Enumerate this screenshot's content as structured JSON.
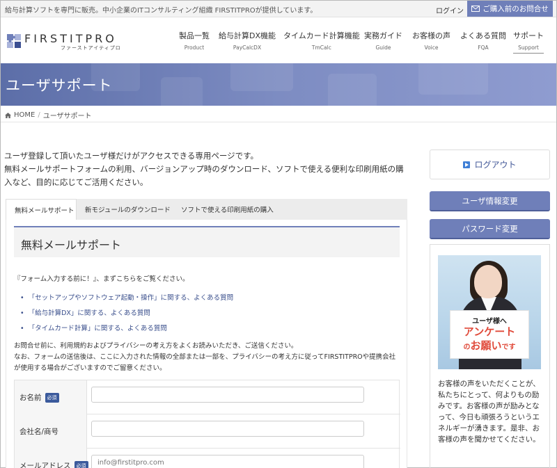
{
  "topbar": {
    "tagline": "給与計算ソフトを専門に販売。中小企業のITコンサルティング組織 FIRSTITPROが提供しています。",
    "login": "ログイン",
    "contact": "ご購入前のお問合せ"
  },
  "logo": {
    "name": "FIRSTITPRO",
    "kana": "ファーストアイティプロ"
  },
  "nav": [
    {
      "jp": "製品一覧",
      "en": "Product"
    },
    {
      "jp": "給与計算DX機能",
      "en": "PayCalcDX"
    },
    {
      "jp": "タイムカード計算機能",
      "en": "TmCalc"
    },
    {
      "jp": "実務ガイド",
      "en": "Guide"
    },
    {
      "jp": "お客様の声",
      "en": "Voice"
    },
    {
      "jp": "よくある質問",
      "en": "FQA"
    },
    {
      "jp": "サポート",
      "en": "Support"
    }
  ],
  "hero": {
    "title": "ユーザサポート"
  },
  "breadcrumb": {
    "home": "HOME",
    "sep": "/",
    "current": "ユーザサポート"
  },
  "intro": {
    "line1": "ユーザ登録して頂いたユーザ様だけがアクセスできる専用ページです。",
    "line2": "無料メールサポートフォームの利用、バージョンアップ時のダウンロード、ソフトで使える便利な印刷用紙の購入など、目的に応じてご活用ください。"
  },
  "tabs": [
    "無料メールサポート",
    "新モジュールのダウンロード",
    "ソフトで使える印刷用紙の購入"
  ],
  "section": {
    "title": "無料メールサポート"
  },
  "note": "『フォーム入力する前に！』、まずこちらをご覧ください。",
  "faq": [
    "「セットアップやソフトウェア起動・操作」に関する、よくある質問",
    "「給与計算DX」に関する、よくある質問",
    "「タイムカード計算」に関する、よくある質問"
  ],
  "notice": {
    "line1": "お問合せ前に、利用規約およびプライバシーの考え方をよくお読みいただき、ご送信ください。",
    "line2": "なお、フォームの送信後は、ここに入力された情報の全部または一部を、プライバシーの考え方に従ってFIRSTITPROや提携会社が使用する場合がございますのでご留意ください。"
  },
  "form": {
    "required": "必須",
    "name_label": "お名前",
    "company_label": "会社名/商号",
    "email_label": "メールアドレス",
    "email_placeholder": "info@firstitpro.com"
  },
  "sidebar": {
    "logout": "ログアウト",
    "user_info": "ユーザ情報変更",
    "password": "パスワード変更",
    "sign1": "ユーザ様へ",
    "sign2": "アンケート",
    "sign3a": "の",
    "sign3b": "お願い",
    "sign3c": "です",
    "survey_text": "お客様の声をいただくことが、私たちにとって、何よりもの励みです。お客様の声が励みとなって、今日も頑張ろうというエネルギーが湧きます。是非、お客様の声を聞かせてください。"
  },
  "colors": {
    "accent": "#6f7fb9",
    "link": "#3a4f8c",
    "hero": "#6f7fb9"
  }
}
